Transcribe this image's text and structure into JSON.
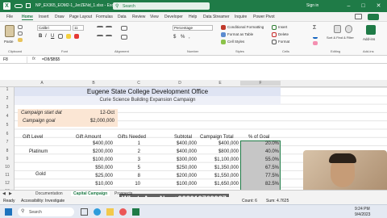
{
  "window": {
    "title": "NP_EX365_EOM2-1_JerZENd_1.xlsx - Excel",
    "search_placeholder": "Search",
    "signin": "Sign in"
  },
  "tabs": [
    "File",
    "Home",
    "Insert",
    "Draw",
    "Page Layout",
    "Formulas",
    "Data",
    "Review",
    "View",
    "Developer",
    "Help",
    "Data Streamer",
    "Inquire",
    "Power Pivot"
  ],
  "ribbon": {
    "font_name": "Calibri",
    "font_size": "11",
    "number_format": "Percentage",
    "groups": [
      "Clipboard",
      "Font",
      "Alignment",
      "Number",
      "Styles",
      "Cells",
      "Editing",
      "Add-ins"
    ],
    "styles_items": [
      "Conditional Formatting",
      "Format as Table",
      "Cell Styles"
    ],
    "cells_items": [
      "Insert",
      "Delete",
      "Format"
    ],
    "editing_label": "Sort & Find & Filter",
    "addins_label": "Add-ins",
    "paste_label": "Paste"
  },
  "formula_bar": {
    "name_box": "F8",
    "fx": "fx",
    "formula": "=D8/$B$5"
  },
  "columns": [
    "A",
    "B",
    "C",
    "D",
    "E",
    "F"
  ],
  "rows": [
    "1",
    "2",
    "3",
    "4",
    "5",
    "6",
    "7",
    "8",
    "9",
    "10",
    "11",
    "12",
    "13",
    "14"
  ],
  "sheet": {
    "title": "Eugene State College Development Office",
    "subtitle": "Curie Science Building Expansion Campaign",
    "start_label": "Campaign start dat",
    "start_value": "12-Oct",
    "goal_label": "Campaign goal",
    "goal_value": "$2,000,000",
    "headers": [
      "Gift Level",
      "Gift Amount",
      "Gifts Needed",
      "Subtotal",
      "Campaign Total",
      "% of Goal"
    ],
    "levels": [
      "Platinum",
      "Gold"
    ],
    "data_rows": [
      [
        "$400,000",
        "1",
        "$400,000",
        "$400,000",
        "20.0%"
      ],
      [
        "$200,000",
        "2",
        "$400,000",
        "$800,000",
        "40.0%"
      ],
      [
        "$100,000",
        "3",
        "$300,000",
        "$1,100,000",
        "55.0%"
      ],
      [
        "$50,000",
        "5",
        "$250,000",
        "$1,350,000",
        "67.5%"
      ],
      [
        "$25,000",
        "8",
        "$200,000",
        "$1,550,000",
        "77.5%"
      ],
      [
        "$10,000",
        "10",
        "$100,000",
        "$1,650,000",
        "82.5%"
      ]
    ]
  },
  "sheet_tabs": [
    "Documentation",
    "Capital Campaign",
    "Prospects"
  ],
  "status": {
    "ready": "Ready",
    "accessibility": "Accessibility: Investigate",
    "count": "Count: 6",
    "sum": "Sum: 4.7625"
  },
  "overlay_text": "WhatsApp No: +923019769937",
  "taskbar": {
    "search": "Search",
    "time": "9:24 PM",
    "date": "9/4/2023"
  },
  "colors": {
    "excel_green": "#1f7b47",
    "title_fill": "#dfe4f3",
    "goal_fill": "#fbe6d4",
    "header_fill": "#dfe4f3",
    "selected_fill": "#c6c6c6"
  }
}
